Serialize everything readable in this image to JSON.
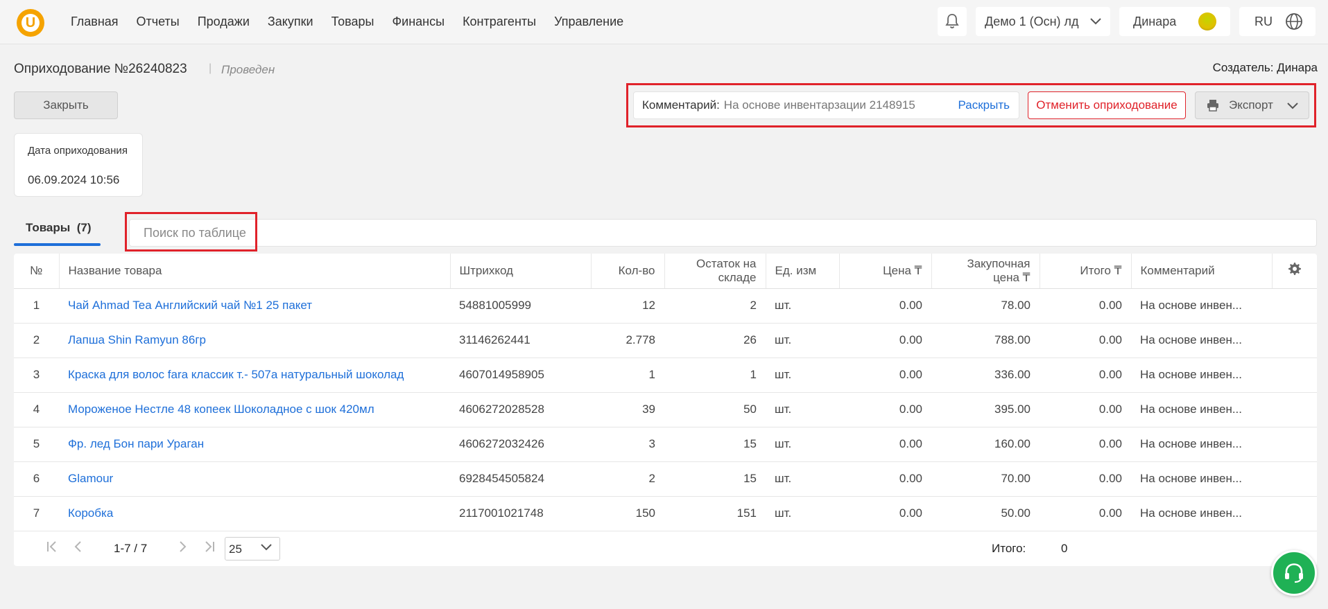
{
  "app": {
    "logo_letter": "U",
    "brand_color": "#f5a300",
    "accent_color": "#1e6fd9",
    "danger_color": "#e0222a"
  },
  "nav": {
    "items": [
      {
        "label": "Главная"
      },
      {
        "label": "Отчеты"
      },
      {
        "label": "Продажи"
      },
      {
        "label": "Закупки"
      },
      {
        "label": "Товары"
      },
      {
        "label": "Финансы"
      },
      {
        "label": "Контрагенты"
      },
      {
        "label": "Управление"
      }
    ]
  },
  "topbar": {
    "org": "Демо 1 (Осн) лд",
    "user": "Динара",
    "lang": "RU"
  },
  "doc": {
    "title": "Оприходование №26240823",
    "separator": "|",
    "status": "Проведен",
    "creator": "Создатель: Динара"
  },
  "actions": {
    "close": "Закрыть",
    "comment_label": "Комментарий:",
    "comment_value": "На основе инвентарзации 2148915",
    "expand": "Раскрыть",
    "cancel": "Отменить оприходование",
    "export": "Экспорт"
  },
  "date_card": {
    "label": "Дата оприходования",
    "value": "06.09.2024 10:56"
  },
  "tabs": [
    {
      "label": "Товары  (7)"
    }
  ],
  "search": {
    "placeholder": "Поиск по таблице"
  },
  "table": {
    "headers": {
      "num": "№",
      "name": "Название товара",
      "barcode": "Штрихкод",
      "qty": "Кол-во",
      "stock": "Остаток на складе",
      "unit": "Ед. изм",
      "price": "Цена ₸",
      "purchase": "Закупочная цена ₸",
      "total": "Итого ₸",
      "comment": "Комментарий"
    },
    "rows": [
      {
        "num": "1",
        "name": "Чай Ahmad Tea Английский чай №1 25 пакет",
        "barcode": "54881005999",
        "qty": "12",
        "stock": "2",
        "unit": "шт.",
        "price": "0.00",
        "purchase": "78.00",
        "total": "0.00",
        "comment": "На основе инвен..."
      },
      {
        "num": "2",
        "name": "Лапша Shin Ramyun 86гр",
        "barcode": "31146262441",
        "qty": "2.778",
        "stock": "26",
        "unit": "шт.",
        "price": "0.00",
        "purchase": "788.00",
        "total": "0.00",
        "comment": "На основе инвен..."
      },
      {
        "num": "3",
        "name": "Краска для волос fara классик т.- 507а натуральный шоколад",
        "barcode": "4607014958905",
        "qty": "1",
        "stock": "1",
        "unit": "шт.",
        "price": "0.00",
        "purchase": "336.00",
        "total": "0.00",
        "comment": "На основе инвен..."
      },
      {
        "num": "4",
        "name": "Мороженое Нестле 48 копеек Шоколадное с шок 420мл",
        "barcode": "4606272028528",
        "qty": "39",
        "stock": "50",
        "unit": "шт.",
        "price": "0.00",
        "purchase": "395.00",
        "total": "0.00",
        "comment": "На основе инвен..."
      },
      {
        "num": "5",
        "name": "Фр. лед Бон пари Ураган",
        "barcode": "4606272032426",
        "qty": "3",
        "stock": "15",
        "unit": "шт.",
        "price": "0.00",
        "purchase": "160.00",
        "total": "0.00",
        "comment": "На основе инвен..."
      },
      {
        "num": "6",
        "name": "Glamour",
        "barcode": "6928454505824",
        "qty": "2",
        "stock": "15",
        "unit": "шт.",
        "price": "0.00",
        "purchase": "70.00",
        "total": "0.00",
        "comment": "На основе инвен..."
      },
      {
        "num": "7",
        "name": "Коробка",
        "barcode": "2117001021748",
        "qty": "150",
        "stock": "151",
        "unit": "шт.",
        "price": "0.00",
        "purchase": "50.00",
        "total": "0.00",
        "comment": "На основе инвен..."
      }
    ]
  },
  "pager": {
    "range": "1-7 / 7",
    "page_size": "25",
    "total_label": "Итого:",
    "total_value": "0"
  }
}
